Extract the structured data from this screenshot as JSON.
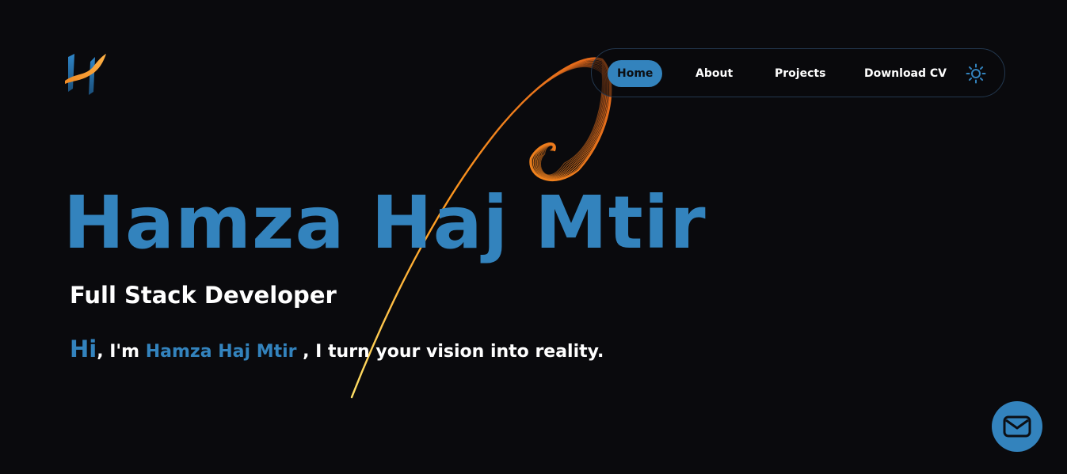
{
  "nav": {
    "items": [
      {
        "label": "Home",
        "active": true
      },
      {
        "label": "About",
        "active": false
      },
      {
        "label": "Projects",
        "active": false
      },
      {
        "label": "Download CV",
        "active": false
      }
    ],
    "theme_icon": "sun-icon"
  },
  "hero": {
    "name": "Hamza Haj Mtir",
    "role": "Full Stack Developer",
    "greeting_hi": "Hi",
    "greeting_mid": ", I'm ",
    "greeting_name": "Hamza Haj Mtir",
    "greeting_tail": " , I turn your vision into reality."
  },
  "contact": {
    "icon": "mail-icon"
  },
  "colors": {
    "accent": "#3383bd",
    "background": "#0a0a0d",
    "swirl": "#ff8c1a"
  }
}
